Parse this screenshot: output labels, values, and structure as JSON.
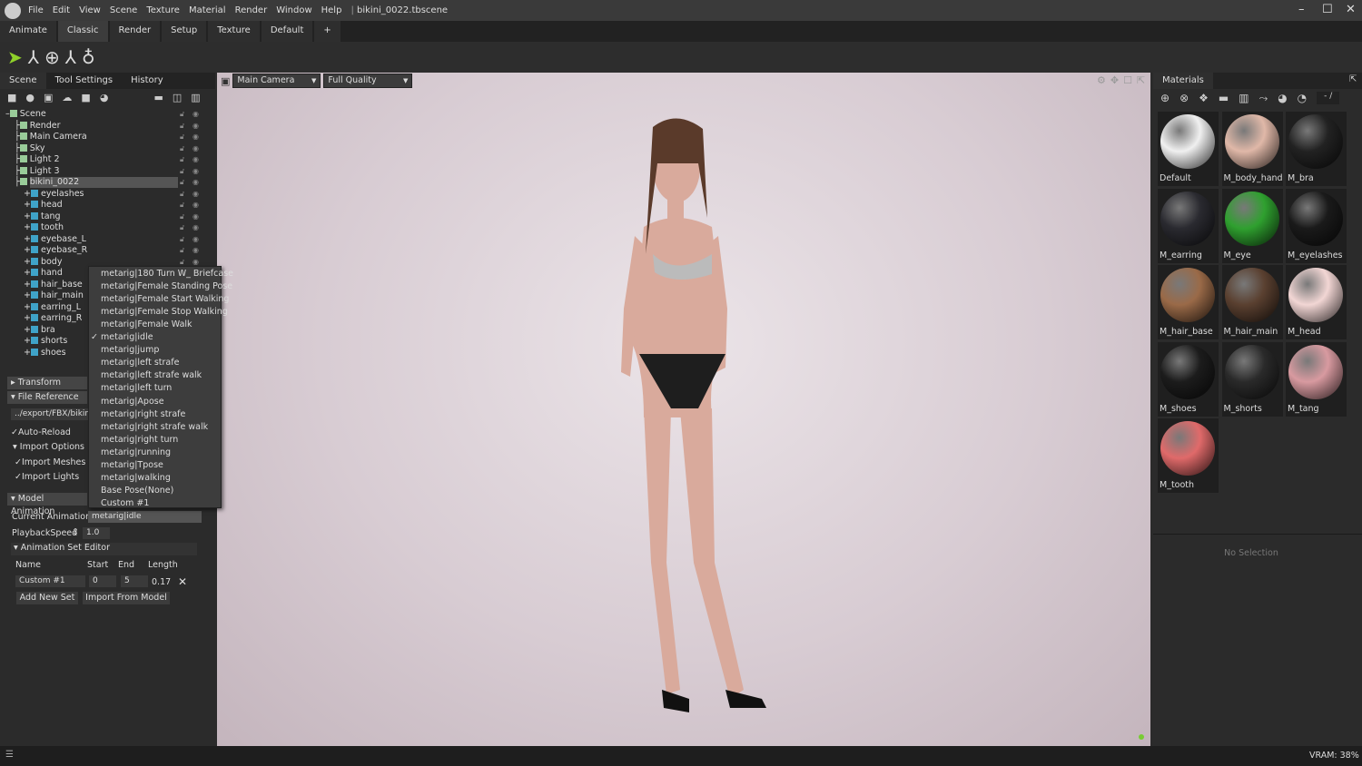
{
  "menu": {
    "items": [
      "File",
      "Edit",
      "View",
      "Scene",
      "Texture",
      "Material",
      "Render",
      "Window",
      "Help"
    ],
    "file": "bikini_0022.tbscene"
  },
  "tabs": [
    "Animate",
    "Classic",
    "Render",
    "Setup",
    "Texture",
    "Default",
    "+"
  ],
  "left": {
    "tabs": [
      "Scene",
      "Tool Settings",
      "History"
    ],
    "tree": [
      {
        "label": "Scene",
        "level": 0
      },
      {
        "label": "Render",
        "level": 1
      },
      {
        "label": "Main Camera",
        "level": 1
      },
      {
        "label": "Sky",
        "level": 1
      },
      {
        "label": "Light 2",
        "level": 1
      },
      {
        "label": "Light 3",
        "level": 1
      },
      {
        "label": "bikini_0022",
        "level": 1,
        "selected": true
      },
      {
        "label": "eyelashes",
        "level": 2
      },
      {
        "label": "head",
        "level": 2
      },
      {
        "label": "tang",
        "level": 2
      },
      {
        "label": "tooth",
        "level": 2
      },
      {
        "label": "eyebase_L",
        "level": 2
      },
      {
        "label": "eyebase_R",
        "level": 2
      },
      {
        "label": "body",
        "level": 2
      },
      {
        "label": "hand",
        "level": 2
      },
      {
        "label": "hair_base",
        "level": 2
      },
      {
        "label": "hair_main",
        "level": 2
      },
      {
        "label": "earring_L",
        "level": 2
      },
      {
        "label": "earring_R",
        "level": 2
      },
      {
        "label": "bra",
        "level": 2
      },
      {
        "label": "shorts",
        "level": 2
      },
      {
        "label": "shoes",
        "level": 2
      }
    ],
    "transform": "Transform",
    "file_reference": "File Reference",
    "file_path": "../export/FBX/bikini",
    "auto_reload": "Auto-Reload",
    "import_options": "Import Options",
    "import_meshes": "Import Meshes",
    "import_lights": "Import Lights",
    "model_animation": "Model Animation",
    "current_animation_label": "Current Animation:",
    "current_animation": "metarig|idle",
    "playback_label": "PlaybackSpeed",
    "playback": "1.0",
    "set_editor": "Animation Set Editor",
    "cols": [
      "Name",
      "Start",
      "End",
      "Length"
    ],
    "set": {
      "name": "Custom #1",
      "start": "0",
      "end": "5",
      "length": "0.17"
    },
    "add_new_set": "Add New Set",
    "import_from_model": "Import From Model"
  },
  "dropdown": {
    "items": [
      "metarig|180 Turn W_ Briefcase",
      "metarig|Female Standing Pose",
      "metarig|Female Start Walking",
      "metarig|Female Stop Walking",
      "metarig|Female Walk",
      "metarig|idle",
      "metarig|jump",
      "metarig|left strafe",
      "metarig|left strafe walk",
      "metarig|left turn",
      "metarig|Apose",
      "metarig|right strafe",
      "metarig|right strafe walk",
      "metarig|right turn",
      "metarig|running",
      "metarig|Tpose",
      "metarig|walking",
      "Base Pose(None)",
      "Custom #1"
    ],
    "checked": "metarig|idle"
  },
  "viewport": {
    "camera": "Main Camera",
    "quality": "Full Quality"
  },
  "materials": {
    "title": "Materials",
    "page": "- /",
    "items": [
      {
        "name": "Default",
        "color": "#f0f0f0"
      },
      {
        "name": "M_body_hand",
        "color": "#e0b8a8"
      },
      {
        "name": "M_bra",
        "color": "#222222"
      },
      {
        "name": "M_earring",
        "color": "#2a2a30"
      },
      {
        "name": "M_eye",
        "color": "#2fa02f"
      },
      {
        "name": "M_eyelashes",
        "color": "#1a1a1a"
      },
      {
        "name": "M_hair_base",
        "color": "#9a6a48"
      },
      {
        "name": "M_hair_main",
        "color": "#5a4030"
      },
      {
        "name": "M_head",
        "color": "#f2d6d4"
      },
      {
        "name": "M_shoes",
        "color": "#1c1c1c"
      },
      {
        "name": "M_shorts",
        "color": "#2a2a2a"
      },
      {
        "name": "M_tang",
        "color": "#d89aa0"
      },
      {
        "name": "M_tooth",
        "color": "#e06a6a"
      }
    ],
    "no_selection": "No Selection"
  },
  "status": {
    "vram": "VRAM: 38%"
  }
}
